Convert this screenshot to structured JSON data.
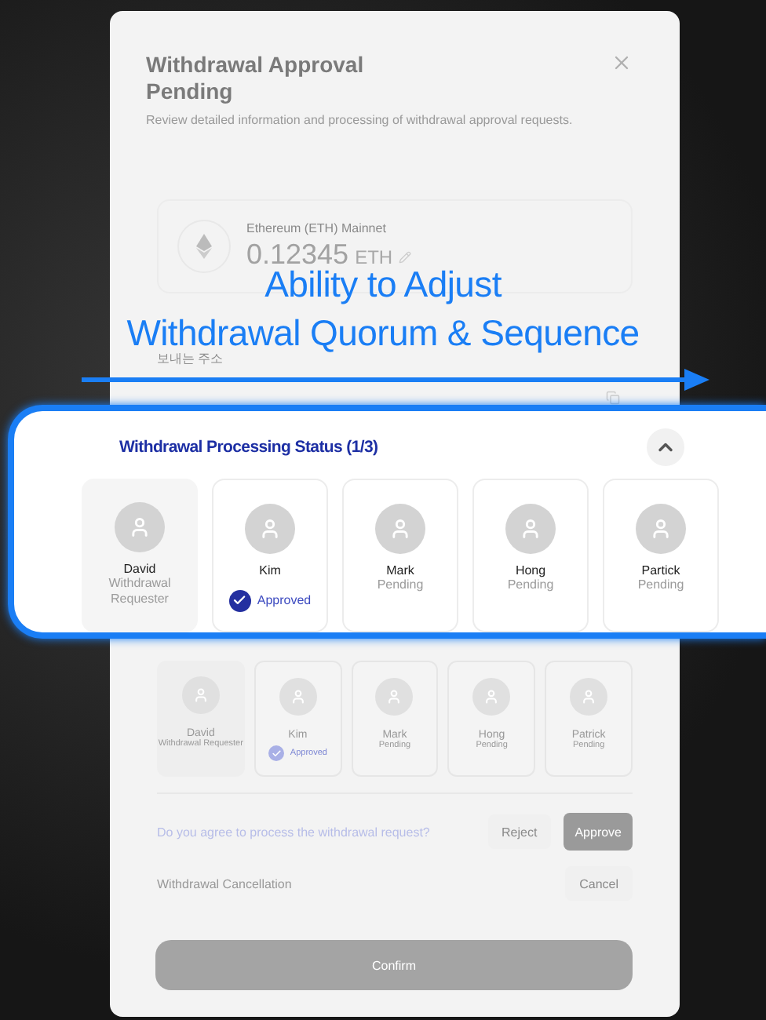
{
  "dialog": {
    "title": "Withdrawal Approval Pending",
    "subtitle": "Review detailed information and processing of withdrawal approval requests.",
    "asset": {
      "network": "Ethereum (ETH) Mainnet",
      "amount": "0.12345",
      "unit": "ETH"
    },
    "address": {
      "label": "보내는 주소"
    },
    "approvers": [
      {
        "name": "David",
        "status": "Withdrawal Requester",
        "kind": "requester"
      },
      {
        "name": "Kim",
        "status": "Approved",
        "kind": "approved"
      },
      {
        "name": "Mark",
        "status": "Pending",
        "kind": "pending"
      },
      {
        "name": "Hong",
        "status": "Pending",
        "kind": "pending"
      },
      {
        "name": "Patrick",
        "status": "Pending",
        "kind": "pending"
      }
    ],
    "agree": {
      "question": "Do you agree to process the withdrawal request?",
      "reject": "Reject",
      "approve": "Approve"
    },
    "cancel": {
      "label": "Withdrawal Cancellation",
      "button": "Cancel"
    },
    "confirm": "Confirm"
  },
  "callout": {
    "headline": [
      "Ability to Adjust",
      "Withdrawal Quorum & Sequence"
    ]
  },
  "status_panel": {
    "title": "Withdrawal Processing Status (1/3)",
    "expanded": true,
    "approvers": [
      {
        "name": "David",
        "status": "Withdrawal Requester",
        "kind": "requester"
      },
      {
        "name": "Kim",
        "status": "Approved",
        "kind": "approved"
      },
      {
        "name": "Mark",
        "status": "Pending",
        "kind": "pending"
      },
      {
        "name": "Hong",
        "status": "Pending",
        "kind": "pending"
      },
      {
        "name": "Partick",
        "status": "Pending",
        "kind": "pending"
      }
    ]
  }
}
